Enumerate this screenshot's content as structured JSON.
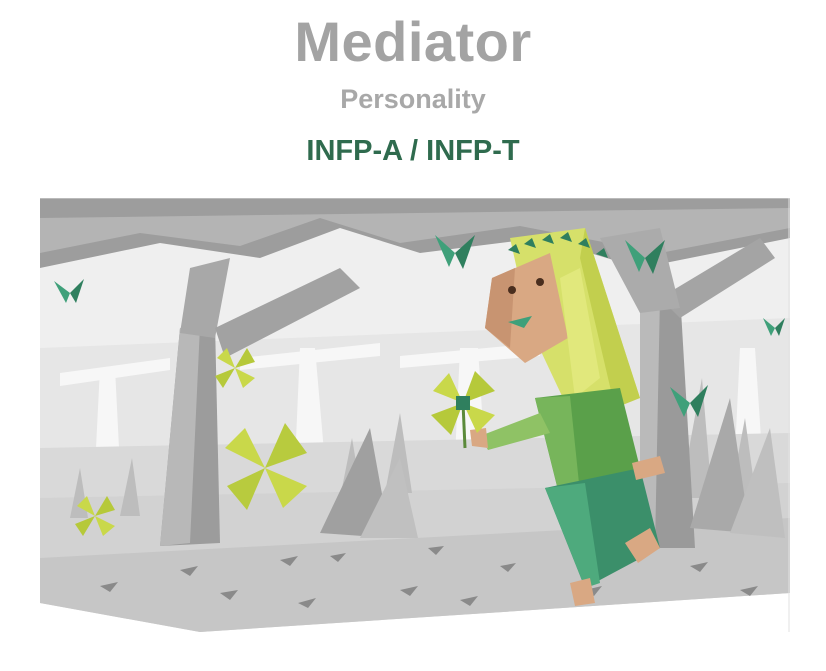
{
  "header": {
    "title": "Mediator",
    "subtitle": "Personality",
    "type_code": "INFP-A / INFP-T"
  },
  "illustration": {
    "subject": "mediator-character-in-forest",
    "colors": {
      "accent_green": "#2f6b4e",
      "lime": "#c9d84a",
      "leaf_teal": "#3fa07a",
      "hair_yellow": "#d6e06a",
      "skin": "#d9a883",
      "gray_trees": "#9a9a9a",
      "ground": "#d0d0d0"
    }
  }
}
